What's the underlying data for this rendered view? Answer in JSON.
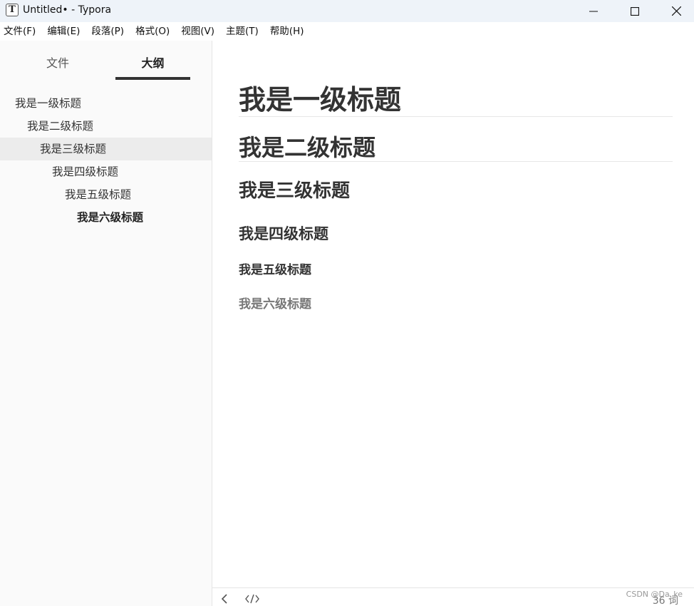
{
  "window": {
    "app_icon": "T",
    "title": "Untitled• - Typora"
  },
  "menu": {
    "items": [
      "文件(F)",
      "编辑(E)",
      "段落(P)",
      "格式(O)",
      "视图(V)",
      "主题(T)",
      "帮助(H)"
    ]
  },
  "sidebar": {
    "tabs": [
      {
        "label": "文件",
        "active": false
      },
      {
        "label": "大纲",
        "active": true
      }
    ],
    "outline": [
      {
        "label": "我是一级标题",
        "level": 1
      },
      {
        "label": "我是二级标题",
        "level": 2
      },
      {
        "label": "我是三级标题",
        "level": 3,
        "active": true
      },
      {
        "label": "我是四级标题",
        "level": 4
      },
      {
        "label": "我是五级标题",
        "level": 5
      },
      {
        "label": "我是六级标题",
        "level": 6
      }
    ]
  },
  "document": {
    "headings": [
      {
        "text": "我是一级标题",
        "level": 1
      },
      {
        "text": "我是二级标题",
        "level": 2
      },
      {
        "text": "我是三级标题",
        "level": 3
      },
      {
        "text": "我是四级标题",
        "level": 4
      },
      {
        "text": "我是五级标题",
        "level": 5
      },
      {
        "text": "我是六级标题",
        "level": 6
      }
    ]
  },
  "status": {
    "word_count": "36 词",
    "watermark": "CSDN @Da_ke"
  },
  "icons": {
    "minimize": "minimize-icon",
    "maximize": "maximize-icon",
    "close": "close-icon",
    "back": "chevron-left-icon",
    "source": "source-code-icon"
  },
  "colors": {
    "titlebar_bg": "#eef3f9",
    "sidebar_bg": "#fafafa",
    "active_outline_bg": "#ececec",
    "text": "#333333",
    "h6_text": "#777777"
  }
}
